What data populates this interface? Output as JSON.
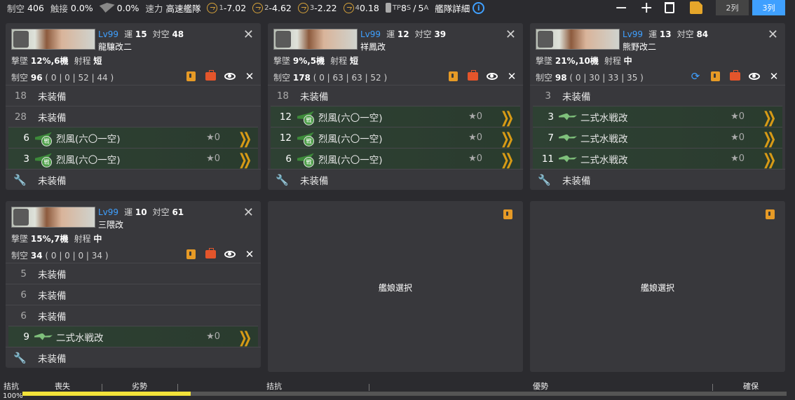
{
  "topbar": {
    "seiku_label": "制空",
    "seiku_value": "406",
    "shokusetsu_label": "触接",
    "shokusetsu_value": "0.0%",
    "aa_ci_value": "0.0%",
    "speed_label": "速力",
    "speed_value": "高速艦隊",
    "los": [
      {
        "idx": "1",
        "value": "-7.02"
      },
      {
        "idx": "2",
        "value": "-4.62"
      },
      {
        "idx": "3",
        "value": "-2.22"
      },
      {
        "idx": "4",
        "value": "0.18"
      }
    ],
    "tp_label": "TP",
    "tp_s": "8",
    "tp_s_sub": "S",
    "tp_a": "5",
    "tp_a_sub": "A",
    "fleet_detail": "艦隊詳細",
    "col2_label": "2列",
    "col3_label": "3列"
  },
  "ships": [
    {
      "lv": "Lv99",
      "luck_label": "運",
      "luck": "15",
      "aa_label": "対空",
      "aa": "48",
      "name": "龍驤改二",
      "gek_label": "撃墜",
      "gek": "12%,6機",
      "range_label": "射程",
      "range": "短",
      "air_label": "制空",
      "air": "96",
      "air_detail": "( 0 | 0 | 52 | 44 )",
      "slots": [
        {
          "n": "18",
          "name": "未装備"
        },
        {
          "n": "28",
          "name": "未装備"
        },
        {
          "n": "6",
          "name": "烈風(六〇一空)",
          "star": "★0"
        },
        {
          "n": "3",
          "name": "烈風(六〇一空)",
          "star": "★0"
        },
        {
          "name": "未装備"
        }
      ]
    },
    {
      "lv": "Lv99",
      "luck_label": "運",
      "luck": "12",
      "aa_label": "対空",
      "aa": "39",
      "name": "祥鳳改",
      "gek_label": "撃墜",
      "gek": "9%,5機",
      "range_label": "射程",
      "range": "短",
      "air_label": "制空",
      "air": "178",
      "air_detail": "( 0 | 63 | 63 | 52 )",
      "slots": [
        {
          "n": "18",
          "name": "未装備"
        },
        {
          "n": "12",
          "name": "烈風(六〇一空)",
          "star": "★0"
        },
        {
          "n": "12",
          "name": "烈風(六〇一空)",
          "star": "★0"
        },
        {
          "n": "6",
          "name": "烈風(六〇一空)",
          "star": "★0"
        },
        {
          "name": "未装備"
        }
      ]
    },
    {
      "lv": "Lv99",
      "luck_label": "運",
      "luck": "13",
      "aa_label": "対空",
      "aa": "84",
      "name": "熊野改二",
      "gek_label": "撃墜",
      "gek": "21%,10機",
      "range_label": "射程",
      "range": "中",
      "air_label": "制空",
      "air": "98",
      "air_detail": "( 0 | 30 | 33 | 35 )",
      "slots": [
        {
          "n": "3",
          "name": "未装備"
        },
        {
          "n": "3",
          "name": "二式水戦改",
          "star": "★0"
        },
        {
          "n": "7",
          "name": "二式水戦改",
          "star": "★0"
        },
        {
          "n": "11",
          "name": "二式水戦改",
          "star": "★0"
        },
        {
          "name": "未装備"
        }
      ]
    },
    {
      "lv": "Lv99",
      "luck_label": "運",
      "luck": "10",
      "aa_label": "対空",
      "aa": "61",
      "name": "三隈改",
      "gek_label": "撃墜",
      "gek": "15%,7機",
      "range_label": "射程",
      "range": "中",
      "air_label": "制空",
      "air": "34",
      "air_detail": "( 0 | 0 | 0 | 34 )",
      "slots": [
        {
          "n": "5",
          "name": "未装備"
        },
        {
          "n": "6",
          "name": "未装備"
        },
        {
          "n": "6",
          "name": "未装備"
        },
        {
          "n": "9",
          "name": "二式水戦改",
          "star": "★0"
        },
        {
          "name": "未装備"
        }
      ]
    }
  ],
  "empty_slot_label": "艦娘選択",
  "airbar": {
    "left_label": "拮抗",
    "pct_label": "100%",
    "labels": [
      "喪失",
      "劣勢",
      "拮抗",
      "優勢",
      "確保"
    ],
    "fill_fraction": 0.22
  }
}
